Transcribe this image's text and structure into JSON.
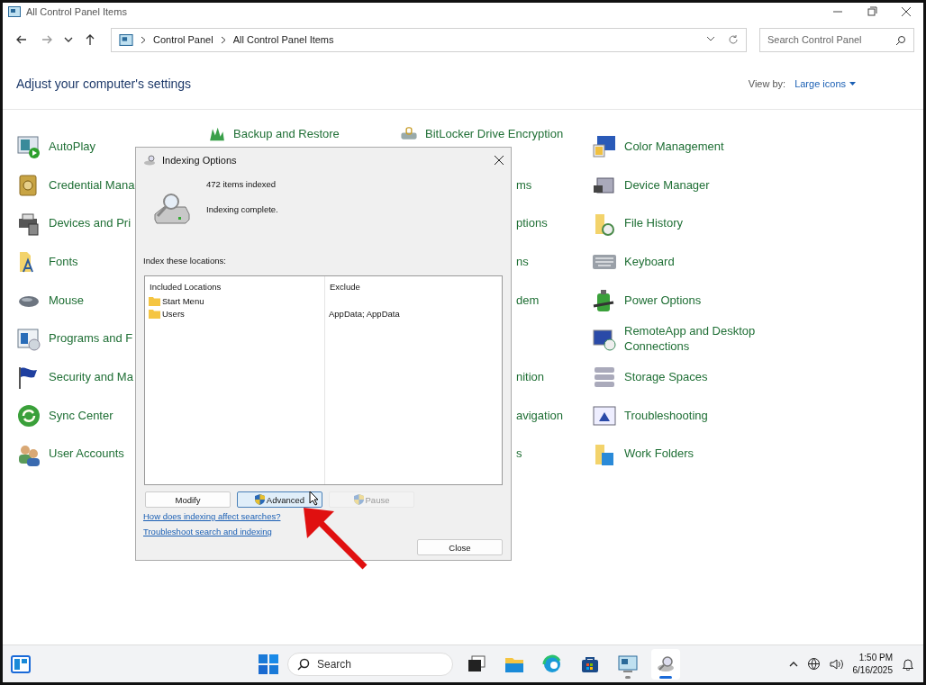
{
  "window": {
    "title": "All Control Panel Items",
    "address": [
      "Control Panel",
      "All Control Panel Items"
    ],
    "search_placeholder": "Search Control Panel"
  },
  "header": {
    "heading": "Adjust your computer's settings",
    "view_by_label": "View by:",
    "view_by_value": "Large icons"
  },
  "columns": [
    [
      {
        "label": "AutoPlay",
        "kind": "full"
      },
      {
        "label": "Credential Mana",
        "kind": "full"
      },
      {
        "label": "Devices and Pri",
        "kind": "full"
      },
      {
        "label": "Fonts",
        "kind": "full"
      },
      {
        "label": "Mouse",
        "kind": "full"
      },
      {
        "label": "Programs and F",
        "kind": "full"
      },
      {
        "label": "Security and Ma",
        "kind": "full"
      },
      {
        "label": "Sync Center",
        "kind": "full"
      },
      {
        "label": "User Accounts",
        "kind": "full"
      }
    ],
    [
      {
        "label": "Backup and Restore",
        "kind": "full"
      }
    ],
    [
      {
        "label": "BitLocker Drive Encryption",
        "kind": "full"
      },
      {
        "label": "ms",
        "kind": "partial"
      },
      {
        "label": "ptions",
        "kind": "partial"
      },
      {
        "label": "ns",
        "kind": "partial"
      },
      {
        "label": "dem",
        "kind": "partial"
      },
      {
        "kind": "none"
      },
      {
        "label": "nition",
        "kind": "partial"
      },
      {
        "label": "avigation",
        "kind": "partial"
      },
      {
        "label": "s",
        "kind": "partial"
      }
    ],
    [
      {
        "label": "Color Management",
        "kind": "full"
      },
      {
        "label": "Device Manager",
        "kind": "full"
      },
      {
        "label": "File History",
        "kind": "full"
      },
      {
        "label": "Keyboard",
        "kind": "full"
      },
      {
        "label": "Power Options",
        "kind": "full"
      },
      {
        "label": "RemoteApp and Desktop Connections",
        "kind": "full"
      },
      {
        "label": "Storage Spaces",
        "kind": "full"
      },
      {
        "label": "Troubleshooting",
        "kind": "full"
      },
      {
        "label": "Work Folders",
        "kind": "full"
      }
    ]
  ],
  "dialog": {
    "title": "Indexing Options",
    "count": "472 items indexed",
    "status": "Indexing complete.",
    "locations_label": "Index these locations:",
    "table": {
      "columns": [
        "Included Locations",
        "Exclude"
      ],
      "rows": [
        {
          "location": "Start Menu"
        },
        {
          "location": "Users",
          "exclude": "AppData; AppData"
        }
      ]
    },
    "buttons": [
      {
        "label": "Modify",
        "kind": "plain",
        "hovered": false,
        "disabled": false
      },
      {
        "label": "Advanced",
        "kind": "shield",
        "hovered": true,
        "disabled": false
      },
      {
        "label": "Pause",
        "kind": "shield",
        "hovered": false,
        "disabled": true
      }
    ],
    "links": [
      "How does indexing affect searches?",
      "Troubleshoot search and indexing"
    ],
    "close_button": "Close"
  },
  "taskbar": {
    "search_placeholder": "Search",
    "time": "1:50 PM",
    "date": "6/16/2025",
    "apps": [
      {
        "kind": "taskview",
        "running": false,
        "active": false
      },
      {
        "kind": "explorer",
        "running": false,
        "active": false
      },
      {
        "kind": "edge",
        "running": false,
        "active": false
      },
      {
        "kind": "store",
        "running": false,
        "active": false
      },
      {
        "kind": "controlpanel",
        "running": true,
        "active": false
      },
      {
        "kind": "indexing",
        "running": true,
        "active": true
      }
    ]
  }
}
